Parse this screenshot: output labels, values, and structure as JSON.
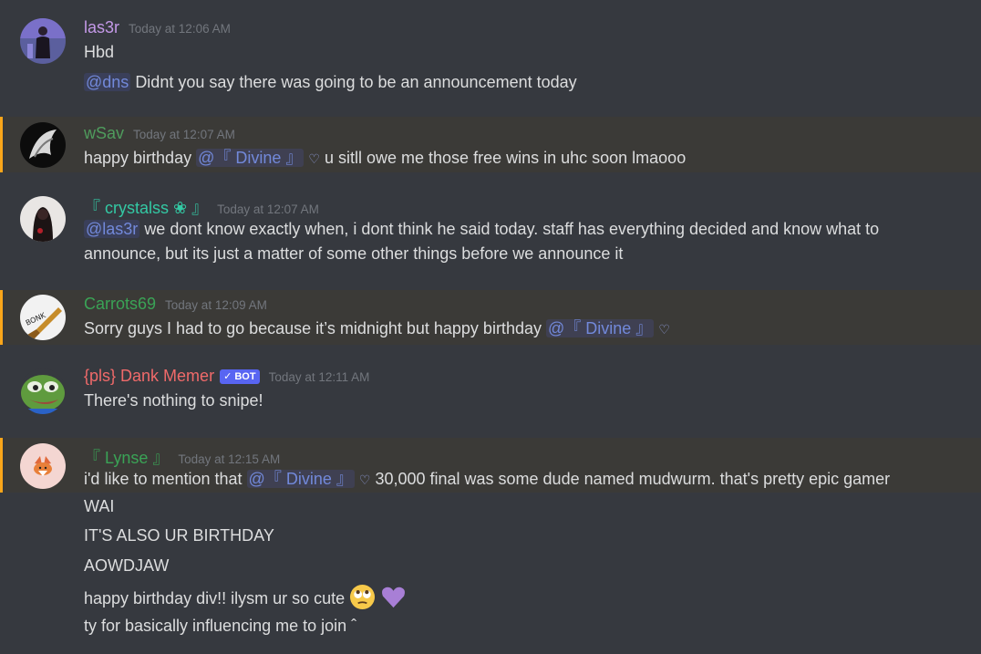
{
  "messages": [
    {
      "author": "las3r",
      "timestamp": "Today at 12:06 AM",
      "lines": [
        "Hbd"
      ],
      "followup": {
        "mention": "@dns",
        "text": "Didnt you say there was going to be an announcement today"
      }
    },
    {
      "author": "wSav",
      "timestamp": "Today at 12:07 AM",
      "before": "happy birthday",
      "mention": "@『 Divine 』",
      "heart": "♡",
      "after": "u sitll owe me those free wins in uhc soon lmaooo"
    },
    {
      "author": "『 crystalss ❀ 』",
      "timestamp": "Today at 12:07 AM",
      "mention": "@las3r",
      "line1": "we dont know exactly when, i dont think he said today. staff has everything decided and know what to",
      "line2": "announce, but its just a matter of some other things before we announce it"
    },
    {
      "author": "Carrots69",
      "timestamp": "Today at 12:09 AM",
      "before": "Sorry guys I had to go because it’s midnight but happy birthday",
      "mention": "@『 Divine 』",
      "heart": "♡",
      "avatar_text": "BONK"
    },
    {
      "author": "{pls} Dank Memer",
      "bot_tag": "✓ BOT",
      "timestamp": "Today at 12:11 AM",
      "text": "There's nothing to snipe!"
    },
    {
      "author": "『 Lynse 』",
      "timestamp": "Today at 12:15 AM",
      "before": "i'd like to mention that",
      "mention": "@『 Divine 』",
      "heart": "♡",
      "after": "30,000 final was some dude named mudwurm. that's pretty epic gamer",
      "followups": [
        "WAI",
        "IT'S ALSO UR BIRTHDAY",
        "AOWDJAW"
      ],
      "emoji_line": "happy birthday div!! ilysm ur so cute",
      "emojis": [
        "rolling-eyes-emoji",
        "purple-heart-emoji"
      ],
      "last_line": "ty for basically influencing me to join ˆ"
    }
  ],
  "colors": {
    "background": "#36393f",
    "highlight_bg": "#3b3a37",
    "highlight_bar": "#faa61a",
    "mention": "#7289da",
    "timestamp": "#72767d"
  }
}
